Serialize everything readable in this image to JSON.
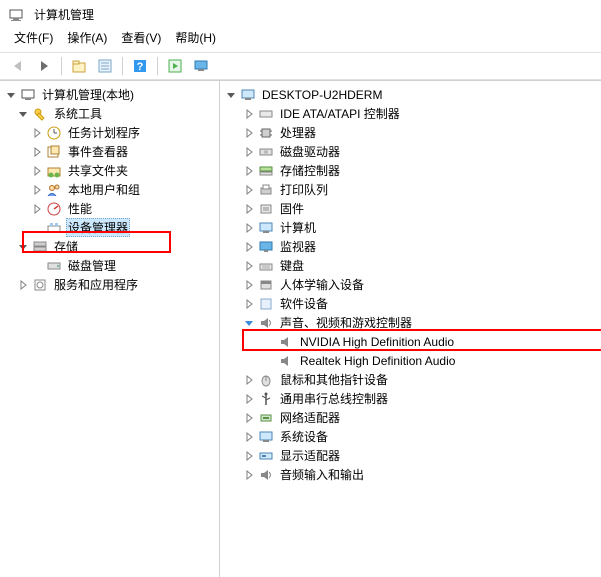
{
  "window": {
    "title": "计算机管理"
  },
  "menu": {
    "file": "文件(F)",
    "action": "操作(A)",
    "view": "查看(V)",
    "help": "帮助(H)"
  },
  "leftTree": {
    "root": "计算机管理(本地)",
    "sysTools": "系统工具",
    "taskScheduler": "任务计划程序",
    "eventViewer": "事件查看器",
    "sharedFolders": "共享文件夹",
    "localUsers": "本地用户和组",
    "performance": "性能",
    "deviceManager": "设备管理器",
    "storage": "存储",
    "diskMgmt": "磁盘管理",
    "services": "服务和应用程序"
  },
  "rightTree": {
    "computer": "DESKTOP-U2HDERM",
    "ide": "IDE ATA/ATAPI 控制器",
    "processors": "处理器",
    "diskDrives": "磁盘驱动器",
    "storageControllers": "存储控制器",
    "printQueues": "打印队列",
    "firmware": "固件",
    "computers": "计算机",
    "monitors": "监视器",
    "keyboards": "键盘",
    "hid": "人体学输入设备",
    "software": "软件设备",
    "sound": "声音、视频和游戏控制器",
    "nvidiaAudio": "NVIDIA High Definition Audio",
    "realtekAudio": "Realtek High Definition Audio",
    "mice": "鼠标和其他指针设备",
    "usb": "通用串行总线控制器",
    "network": "网络适配器",
    "system": "系统设备",
    "display": "显示适配器",
    "audioIO": "音频输入和输出"
  }
}
